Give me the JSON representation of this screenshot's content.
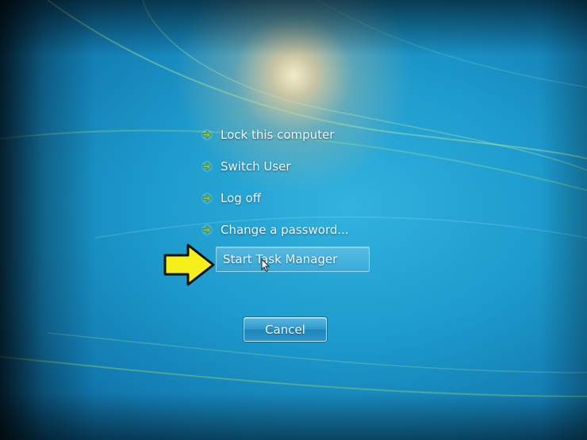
{
  "menu": {
    "items": [
      {
        "label": "Lock this computer",
        "icon": "green-arrow-icon"
      },
      {
        "label": "Switch User",
        "icon": "green-arrow-icon"
      },
      {
        "label": "Log off",
        "icon": "green-arrow-icon"
      },
      {
        "label": "Change a password...",
        "icon": "green-arrow-icon"
      },
      {
        "label": "Start Task Manager",
        "icon": "green-arrow-icon",
        "highlighted": true
      }
    ]
  },
  "buttons": {
    "cancel_label": "Cancel"
  },
  "annotation": {
    "icon": "yellow-pointer-arrow-icon",
    "color": "#f5ef1a"
  },
  "colors": {
    "background": "#1d9bcd",
    "text": "#f2f7fb",
    "icon_green": "#7ec94a"
  }
}
